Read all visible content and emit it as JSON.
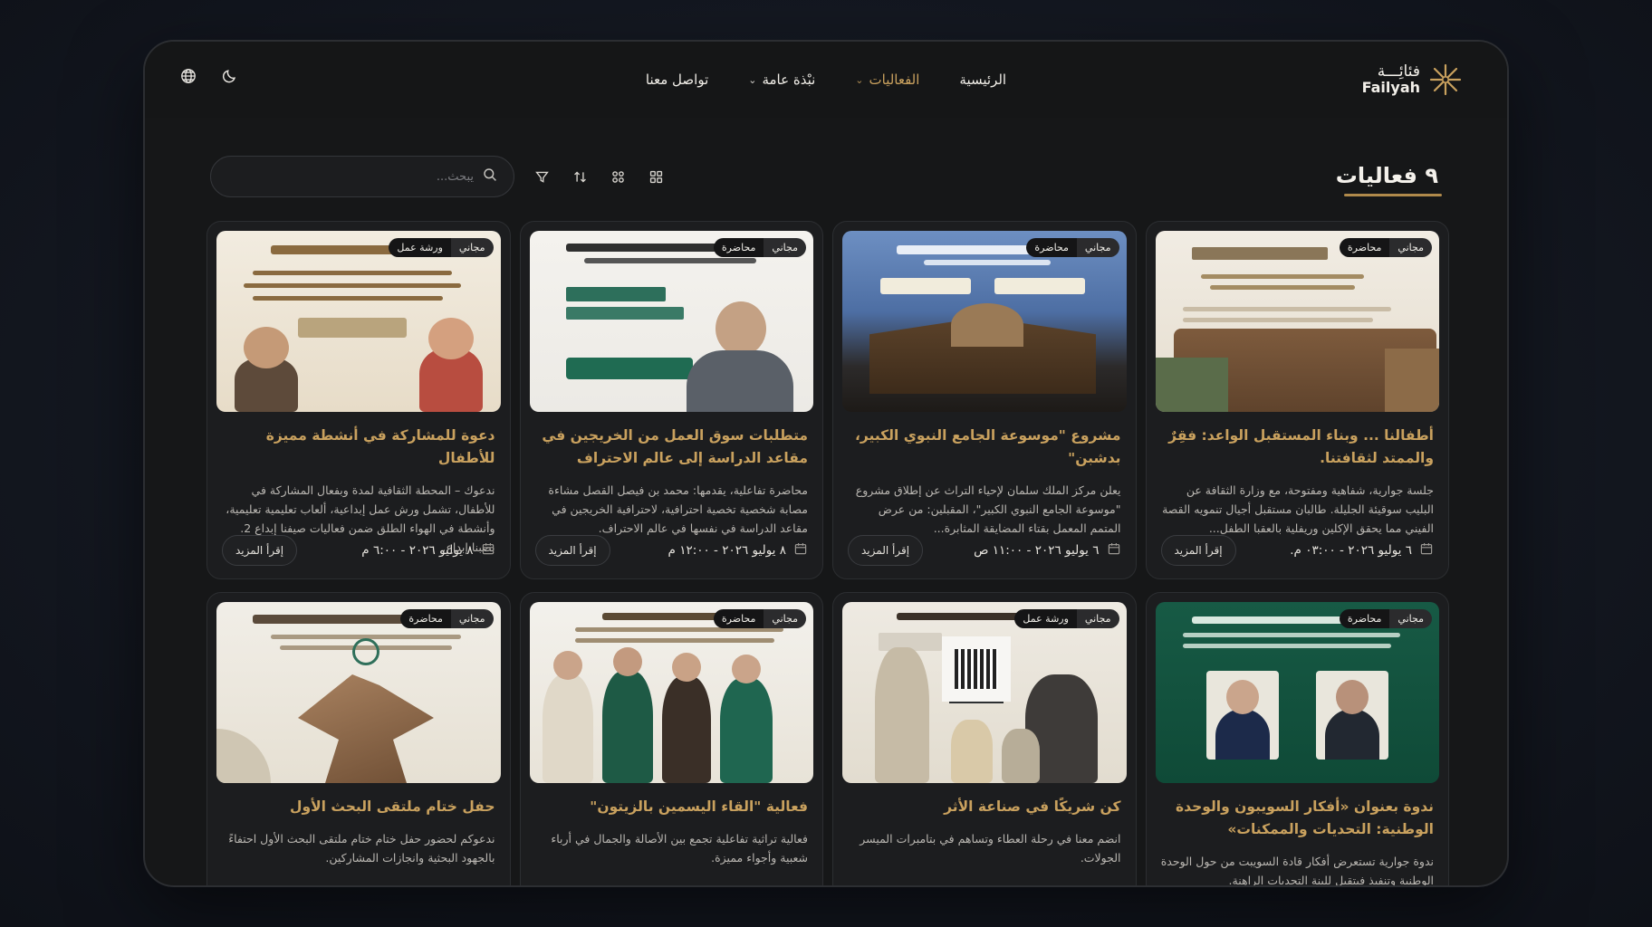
{
  "brand": {
    "name_ar": "فئائِـــة",
    "name_en": "Failyah"
  },
  "nav": [
    {
      "label": "الرئيسية",
      "active": false,
      "dropdown": false
    },
    {
      "label": "الفعاليات",
      "active": true,
      "dropdown": true
    },
    {
      "label": "نبْذة عامة",
      "active": false,
      "dropdown": true
    },
    {
      "label": "تواصل معنا",
      "active": false,
      "dropdown": false
    }
  ],
  "tools": {
    "theme_icon": "moon-icon",
    "language_icon": "globe-icon"
  },
  "events_count_title": "٩ فعاليات",
  "search": {
    "placeholder": "يبحث..."
  },
  "view_tools": [
    "filter-icon",
    "sort-icon",
    "grid-small-icon",
    "grid-large-icon"
  ],
  "colors": {
    "accent": "#c9a15e",
    "background": "#161718",
    "card": "#1c1d1f"
  },
  "cards": [
    {
      "badge_price": "مجاني",
      "badge_type": "محاضرة",
      "title": "أطفالنا ... وبناء المستقبل الواعد: فقِرٌ والممتد لثقافتنا.",
      "description": "جلسة جوارية، شفاهية ومفتوحة، مع وزارة الثقافة عن البليب سوقيئة الجليلة. طالبان مستقبل أجيال تنمويه القصة الفيني مما يحقق الإكلين وريفلية بالعقبا الطفل...",
      "date": "٦ يوليو ٢٠٢٦ - ٠٣:٠٠ م.",
      "read_more": "إقرأ المزيد"
    },
    {
      "badge_price": "مجاني",
      "badge_type": "محاضرة",
      "title": "مشروع \"موسوعة الجامع النبوي الكبير، بدشبن\"",
      "description": "يعلن مركز الملك سلمان لإحياء التراث عن إطلاق مشروع \"موسوعة الجامع النبوي الكبير\"، المقبلين: من عرض المتمم المعمل بقتاء المضايقة المثابرة...",
      "date": "٦ يوليو ٢٠٢٦ - ١١:٠٠ ص",
      "read_more": "إقرأ المزيد"
    },
    {
      "badge_price": "مجاني",
      "badge_type": "محاضرة",
      "title": "متطلبات سوق العمل من الخريجين في مقاعد الدراسة إلى عالم الاحتراف",
      "description": "محاضرة تفاعلية، يقدمها: محمد بن فيصل القصل مشاءة مصابة شخصية تخصية احترافية، لاحترافية الخريجين في مقاعد الدراسة في نفسها في عالم الاحتراف.",
      "date": "٨ يوليو ٢٠٢٦ - ١٢:٠٠ م",
      "read_more": "إقرأ المزيد"
    },
    {
      "badge_price": "مجاني",
      "badge_type": "ورشة عمل",
      "title": "دعوة للمشاركة في أنشطة مميزة للأطفال",
      "description": "ندعوك – المحطة الثقافية لمدة وبفعال المشاركة في للأطفال، تشمل ورش عمل إبداعية، ألعاب تعليمية تعليمية، وأنشطة في الهواء الطلق ضمن فعاليات صيفنا إبداع 2. بصبنا إبداع.",
      "date": "٨ يوليو ٢٠٢٦ - ٦:٠٠ م",
      "read_more": "إقرأ المزيد"
    },
    {
      "badge_price": "مجاني",
      "badge_type": "محاضرة",
      "title": "ندوة بعنوان «أفكار السويبون والوحدة الوطنية: التحديات والممكنات»",
      "description": "ندوة جوارية تستعرض أفكار قادة السويبت من حول الوحدة الوطنية وتنفيذ فيتقبل للبنة التحديات الراهنة.",
      "date": "",
      "read_more": ""
    },
    {
      "badge_price": "مجاني",
      "badge_type": "ورشة عمل",
      "title": "كن شريكًا في صناعة الأثر",
      "description": "انضم معنا في رحلة العطاء وتساهم في بتامبرات الميسر الجولات.",
      "date": "",
      "read_more": ""
    },
    {
      "badge_price": "مجاني",
      "badge_type": "محاضرة",
      "title": "فعالية \"القاء اليسمين بالزيتون\"",
      "description": "فعالية تراثية تفاعلية تجمع بين الأصالة والجمال في أرباء شعبية وأجواء مميزة.",
      "date": "",
      "read_more": ""
    },
    {
      "badge_price": "مجاني",
      "badge_type": "محاضرة",
      "title": "حفل ختام ملتقى البحث الأول",
      "description": "ندعوكم لحضور حفل ختام ختام ملتقى البحث الأول احتفاءً بالجهود البحثية وانجازات المشاركين.",
      "date": "",
      "read_more": ""
    }
  ]
}
